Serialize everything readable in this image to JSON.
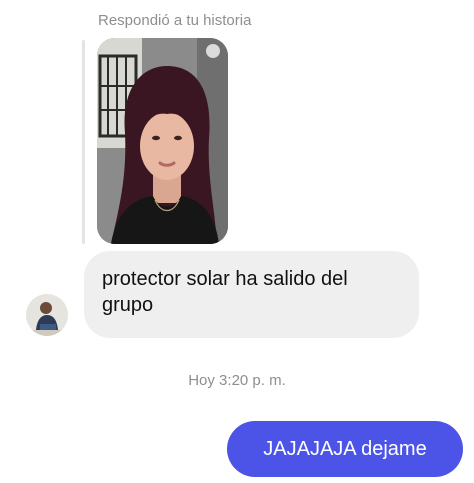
{
  "story_reply": {
    "label": "Respondió a tu historia"
  },
  "messages": [
    {
      "direction": "incoming",
      "text": "protector solar ha salido del grupo"
    },
    {
      "direction": "outgoing",
      "text": "JAJAJAJA dejame"
    }
  ],
  "timestamp": "Hoy 3:20 p. m.",
  "colors": {
    "outgoing_bubble": "#4b54e6",
    "incoming_bubble": "#efefef",
    "meta_text": "#8e8e8e"
  }
}
